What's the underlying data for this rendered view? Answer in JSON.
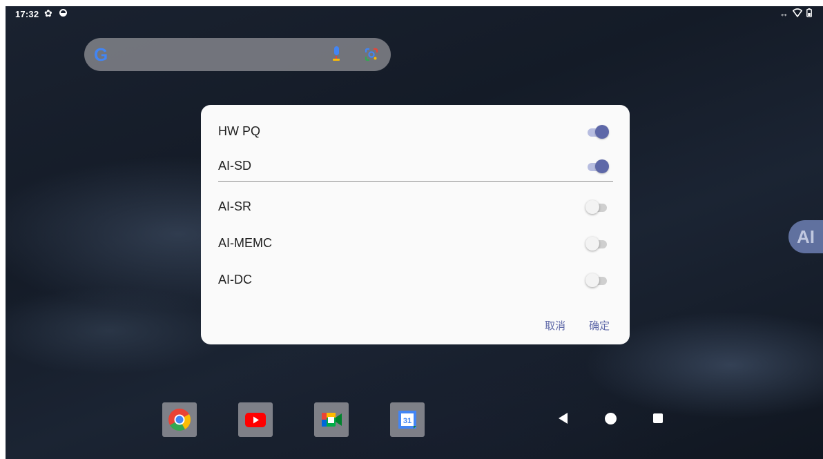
{
  "status_bar": {
    "time": "17:32",
    "icons": [
      "settings-gear-icon",
      "vpn-shield-icon",
      "data-arrows-icon",
      "wifi-icon",
      "battery-icon"
    ]
  },
  "search_widget": {
    "logo": "G",
    "icons": [
      "google-logo-icon",
      "mic-icon",
      "lens-icon"
    ]
  },
  "ai_button": {
    "label": "AI"
  },
  "dialog": {
    "items": [
      {
        "label": "HW PQ",
        "enabled": true
      },
      {
        "label": "AI-SD",
        "enabled": true
      },
      {
        "label": "AI-SR",
        "enabled": false
      },
      {
        "label": "AI-MEMC",
        "enabled": false
      },
      {
        "label": "AI-DC",
        "enabled": false
      }
    ],
    "cancel_label": "取消",
    "ok_label": "确定"
  },
  "dock": {
    "apps": [
      "chrome-icon",
      "youtube-icon",
      "meet-icon",
      "calendar-icon"
    ],
    "calendar_day": "31"
  },
  "nav_bar": {
    "buttons": [
      "back-icon",
      "home-icon",
      "recents-icon"
    ]
  },
  "colors": {
    "accent": "#5e68a8",
    "switch_on_track": "#b7bde0",
    "dialog_bg": "#fafafa",
    "ai_button": "#6d7fb3"
  }
}
